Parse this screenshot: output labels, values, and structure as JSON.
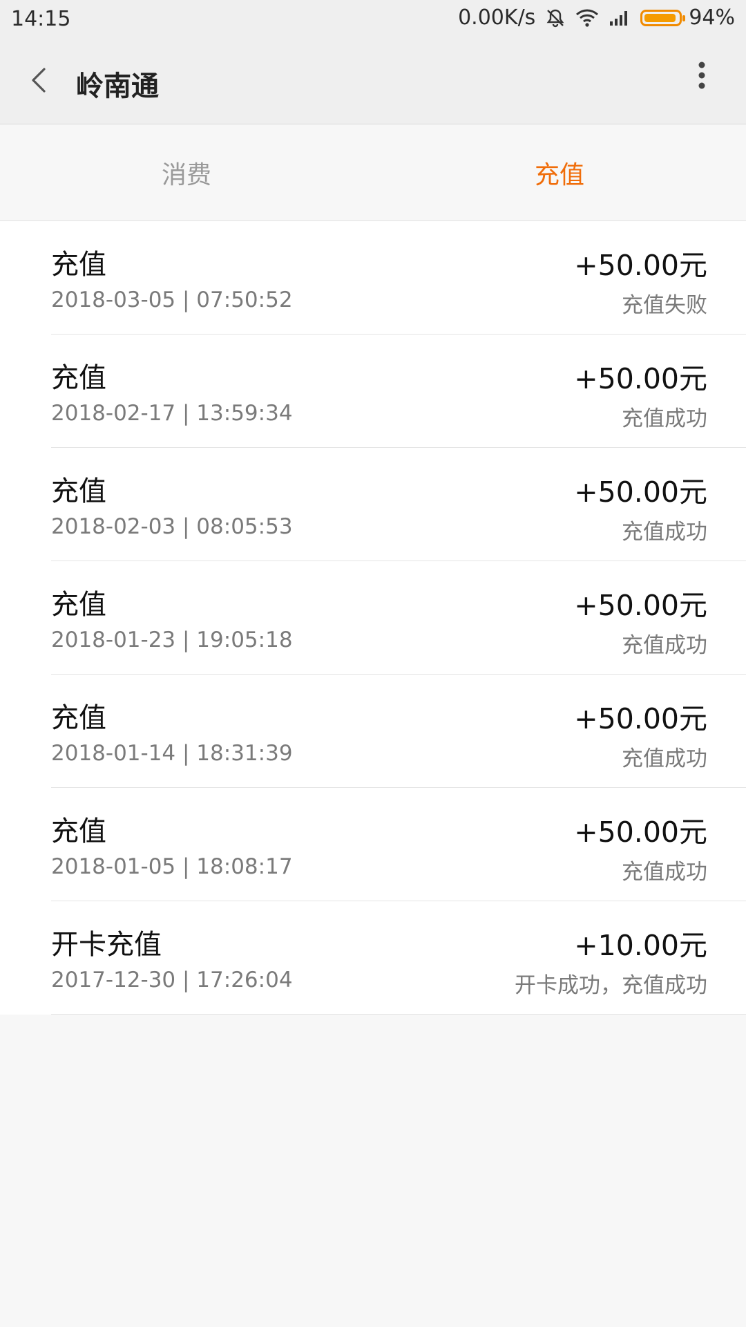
{
  "statusbar": {
    "time": "14:15",
    "speed": "0.00K/s",
    "battery": "94%",
    "battery_level": 0.94,
    "battery_color": "#f59b00"
  },
  "header": {
    "title": "岭南通",
    "back_icon": "chevron-left-icon",
    "more_icon": "more-vertical-icon"
  },
  "tabs": [
    {
      "label": "消费",
      "active": false
    },
    {
      "label": "充值",
      "active": true
    }
  ],
  "colors": {
    "accent": "#f06d0a"
  },
  "records": [
    {
      "title": "充值",
      "datetime": "2018-03-05 | 07:50:52",
      "amount": "+50.00元",
      "status": "充值失败"
    },
    {
      "title": "充值",
      "datetime": "2018-02-17 | 13:59:34",
      "amount": "+50.00元",
      "status": "充值成功"
    },
    {
      "title": "充值",
      "datetime": "2018-02-03 | 08:05:53",
      "amount": "+50.00元",
      "status": "充值成功"
    },
    {
      "title": "充值",
      "datetime": "2018-01-23 | 19:05:18",
      "amount": "+50.00元",
      "status": "充值成功"
    },
    {
      "title": "充值",
      "datetime": "2018-01-14 | 18:31:39",
      "amount": "+50.00元",
      "status": "充值成功"
    },
    {
      "title": "充值",
      "datetime": "2018-01-05 | 18:08:17",
      "amount": "+50.00元",
      "status": "充值成功"
    },
    {
      "title": "开卡充值",
      "datetime": "2017-12-30 | 17:26:04",
      "amount": "+10.00元",
      "status": "开卡成功，充值成功"
    }
  ]
}
